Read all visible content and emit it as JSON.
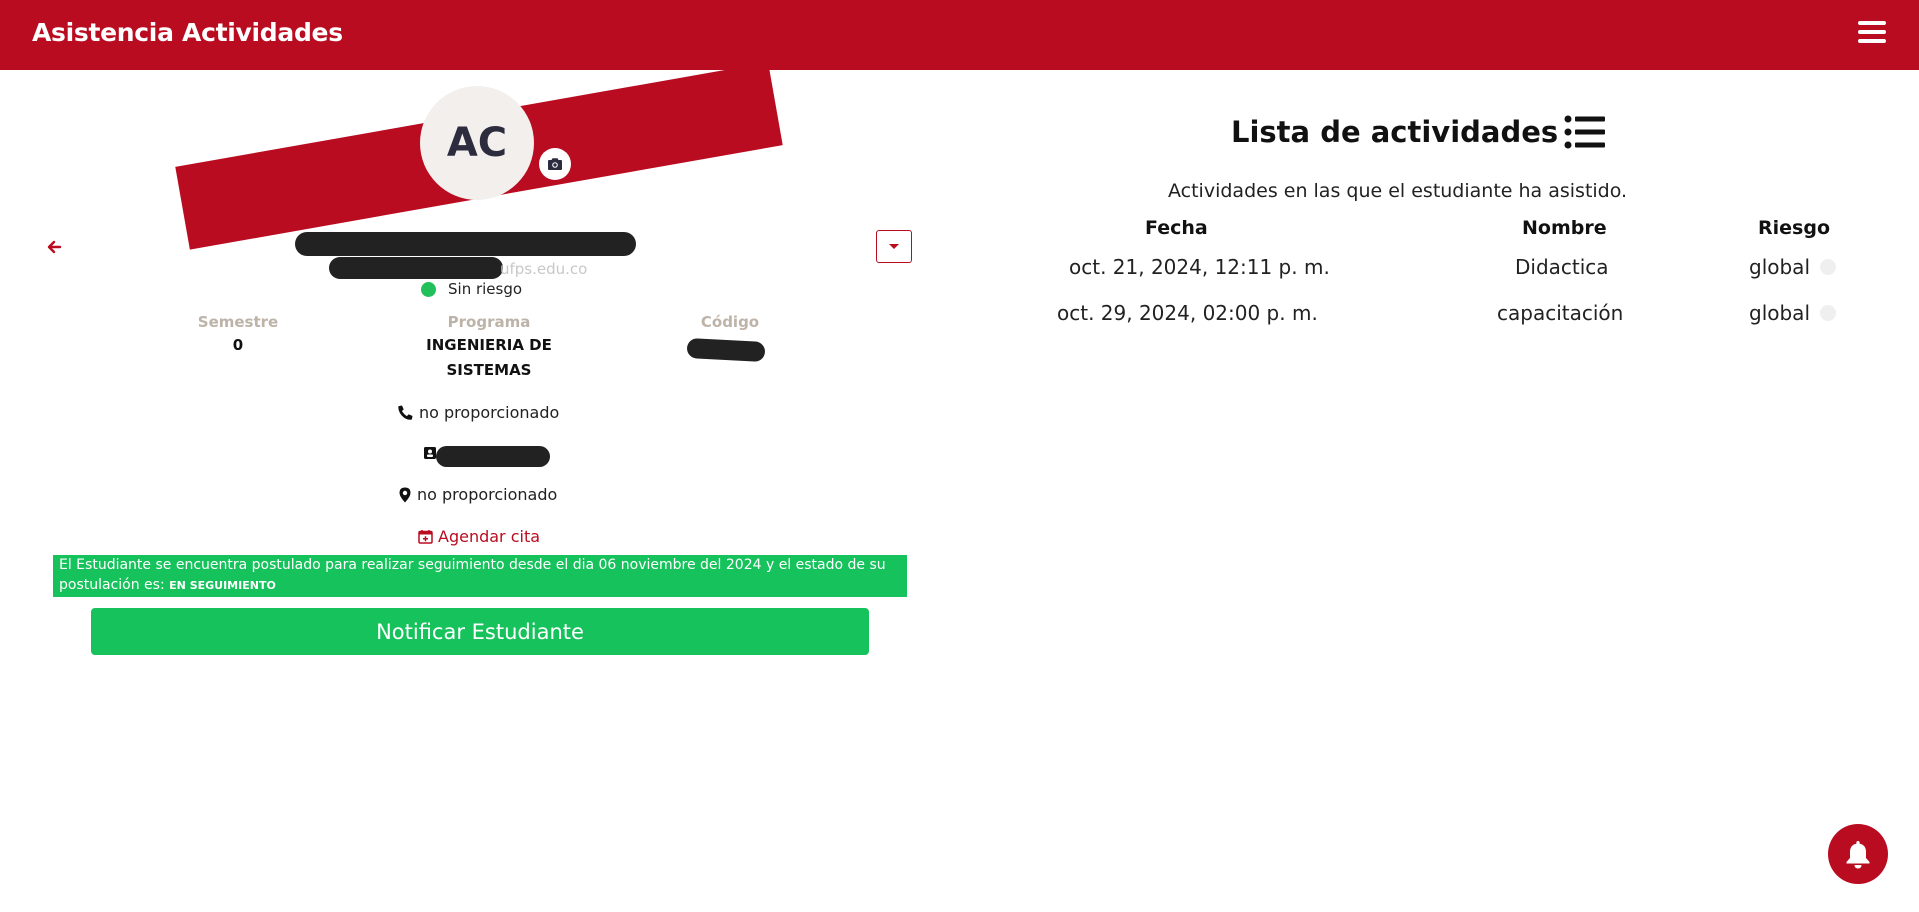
{
  "header": {
    "title": "Asistencia Actividades",
    "menu_icon": "hamburger-menu-icon"
  },
  "profile": {
    "initials": "AC",
    "email_suffix": "ufps.edu.co",
    "status": "Sin riesgo",
    "status_color": "#22c05a",
    "semester_label": "Semestre",
    "semester_value": "0",
    "program_label": "Programa",
    "program_value": "INGENIERIA DE SISTEMAS",
    "code_label": "Código",
    "phone": "no proporcionado",
    "address": "no proporcionado",
    "schedule_label": "Agendar cita"
  },
  "notice": {
    "text": "El Estudiante se encuentra postulado para realizar seguimiento desde el dia 06 noviembre del 2024 y el estado de su postulación es:",
    "state": "EN SEGUIMIENTO"
  },
  "notify_button": "Notificar Estudiante",
  "activities": {
    "title": "Lista de actividades",
    "subtitle": "Actividades en las que el estudiante ha asistido.",
    "columns": [
      "Fecha",
      "Nombre",
      "Riesgo"
    ],
    "rows": [
      {
        "fecha": "oct. 21, 2024, 12:11 p. m.",
        "nombre": "Didactica",
        "riesgo": "global"
      },
      {
        "fecha": "oct. 29, 2024, 02:00 p. m.",
        "nombre": "capacitación",
        "riesgo": "global"
      }
    ]
  },
  "colors": {
    "brand": "#b90c20",
    "success": "#15c25b"
  }
}
